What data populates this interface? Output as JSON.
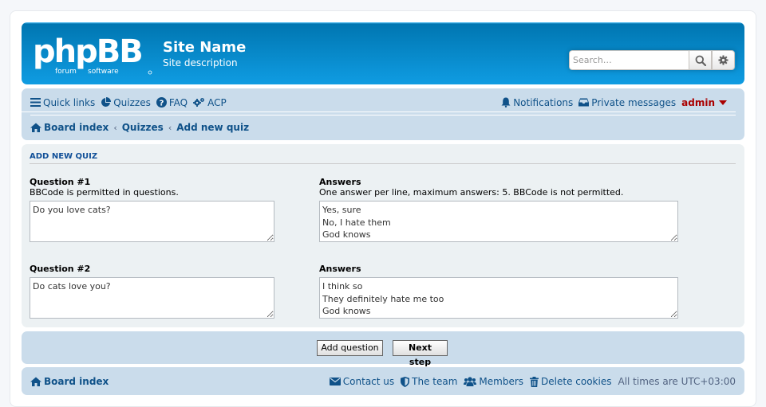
{
  "header": {
    "logo_text": "phpBB",
    "logo_sub_1": "forum",
    "logo_sub_2": "software",
    "site_name": "Site Name",
    "site_description": "Site description",
    "search_placeholder": "Search…",
    "brand_color": "#12a3eb"
  },
  "nav": {
    "quick_links": "Quick links",
    "quizzes": "Quizzes",
    "faq": "FAQ",
    "acp": "ACP",
    "notifications": "Notifications",
    "private_messages": "Private messages",
    "user": "admin"
  },
  "breadcrumb": [
    "Board index",
    "Quizzes",
    "Add new quiz"
  ],
  "form": {
    "title": "ADD NEW QUIZ",
    "questions": [
      {
        "label": "Question #1",
        "hint": "BBCode is permitted in questions.",
        "value": "Do you love cats?",
        "answers_label": "Answers",
        "answers_hint": "One answer per line, maximum answers: 5. BBCode is not permitted.",
        "answers_value": "Yes, sure\nNo, I hate them\nGod knows"
      },
      {
        "label": "Question #2",
        "value": "Do cats love you?",
        "answers_label": "Answers",
        "answers_value": "I think so\nThey definitely hate me too\nGod knows"
      }
    ]
  },
  "actions": {
    "add_question": "Add question",
    "next_step": "Next step"
  },
  "footer": {
    "board_index": "Board index",
    "contact_us": "Contact us",
    "the_team": "The team",
    "members": "Members",
    "delete_cookies": "Delete cookies",
    "timezone": "All times are UTC+03:00"
  }
}
